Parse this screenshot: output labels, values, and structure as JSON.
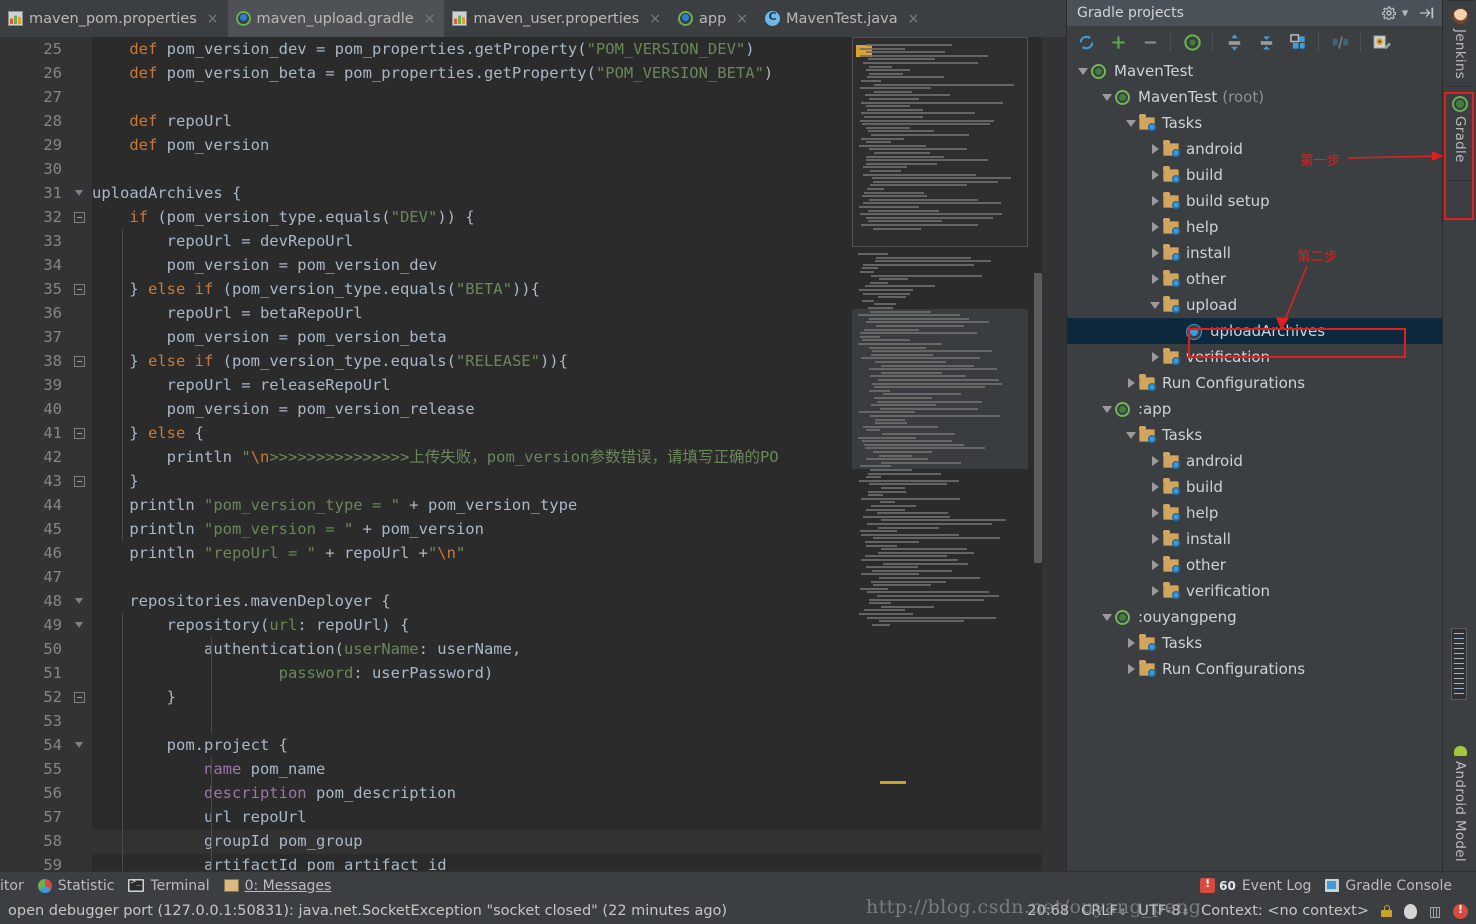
{
  "tabs": [
    {
      "label": "maven_pom.properties",
      "icon": "properties-file-icon",
      "active": false
    },
    {
      "label": "maven_upload.gradle",
      "icon": "gradle-file-icon",
      "active": true
    },
    {
      "label": "maven_user.properties",
      "icon": "properties-file-icon",
      "active": false
    },
    {
      "label": "app",
      "icon": "gradle-file-icon",
      "active": false
    },
    {
      "label": "MavenTest.java",
      "icon": "java-class-icon",
      "active": false
    }
  ],
  "editor": {
    "first_line": 25,
    "lines": [
      {
        "n": 25,
        "html": "    <span class=\"kw\">def</span> pom_version_dev = pom_properties.getProperty(<span class=\"str\">\"POM_VERSION_DEV\"</span>)"
      },
      {
        "n": 26,
        "html": "    <span class=\"kw\">def</span> pom_version_beta = pom_properties.getProperty(<span class=\"str\">\"POM_VERSION_BETA\"</span>)"
      },
      {
        "n": 27,
        "html": ""
      },
      {
        "n": 28,
        "html": "    <span class=\"kw\">def</span> repoUrl"
      },
      {
        "n": 29,
        "html": "    <span class=\"kw\">def</span> pom_version"
      },
      {
        "n": 30,
        "html": ""
      },
      {
        "n": 31,
        "html": "uploadArchives {"
      },
      {
        "n": 32,
        "html": "    <span class=\"kw\">if</span> (pom_version_type.equals(<span class=\"str\">\"DEV\"</span>)) {"
      },
      {
        "n": 33,
        "html": "        repoUrl = devRepoUrl"
      },
      {
        "n": 34,
        "html": "        pom_version = pom_version_dev"
      },
      {
        "n": 35,
        "html": "    } <span class=\"kw\">else if</span> (pom_version_type.equals(<span class=\"str\">\"BETA\"</span>)){"
      },
      {
        "n": 36,
        "html": "        repoUrl = betaRepoUrl"
      },
      {
        "n": 37,
        "html": "        pom_version = pom_version_beta"
      },
      {
        "n": 38,
        "html": "    } <span class=\"kw\">else if</span> (pom_version_type.equals(<span class=\"str\">\"RELEASE\"</span>)){"
      },
      {
        "n": 39,
        "html": "        repoUrl = releaseRepoUrl"
      },
      {
        "n": 40,
        "html": "        pom_version = pom_version_release"
      },
      {
        "n": 41,
        "html": "    } <span class=\"kw\">else</span> {"
      },
      {
        "n": 42,
        "html": "        println <span class=\"str\">\"<span class=\"esc\">\\n</span>&gt;&gt;&gt;&gt;&gt;&gt;&gt;&gt;&gt;&gt;&gt;&gt;&gt;&gt;&gt;上传失败，pom_version参数错误，请填写正确的PO</span>"
      },
      {
        "n": 43,
        "html": "    }"
      },
      {
        "n": 44,
        "html": "    println <span class=\"str\">\"pom_version_type = \"</span> + pom_version_type"
      },
      {
        "n": 45,
        "html": "    println <span class=\"str\">\"pom_version = \"</span> + pom_version"
      },
      {
        "n": 46,
        "html": "    println <span class=\"str\">\"repoUrl = \"</span> + repoUrl +<span class=\"str\">\"<span class=\"esc\">\\n</span>\"</span>"
      },
      {
        "n": 47,
        "html": ""
      },
      {
        "n": 48,
        "html": "    repositories.mavenDeployer {"
      },
      {
        "n": 49,
        "html": "        repository(<span class=\"lbl\">url</span>: repoUrl) {"
      },
      {
        "n": 50,
        "html": "            authentication(<span class=\"lbl\">userName</span>: userName,"
      },
      {
        "n": 51,
        "html": "                    <span class=\"lbl\">password</span>: userPassword)"
      },
      {
        "n": 52,
        "html": "        }"
      },
      {
        "n": 53,
        "html": ""
      },
      {
        "n": 54,
        "html": "        pom.project {"
      },
      {
        "n": 55,
        "html": "            <span class=\"attr\">name</span> pom_name"
      },
      {
        "n": 56,
        "html": "            <span class=\"attr\">description</span> pom_description"
      },
      {
        "n": 57,
        "html": "            url repoUrl"
      },
      {
        "n": 58,
        "html": "            groupId pom_group"
      },
      {
        "n": 59,
        "html": "            artifactId pom_artifact_id"
      }
    ]
  },
  "gradle_panel": {
    "title": "Gradle projects",
    "toolbar": [
      {
        "name": "refresh-all-gradle-projects-icon",
        "glyph": "refresh"
      },
      {
        "name": "attach-gradle-project-icon",
        "glyph": "plus"
      },
      {
        "name": "detach-external-project-icon",
        "glyph": "minus"
      },
      {
        "name": "execute-gradle-task-icon",
        "glyph": "gradle"
      },
      {
        "name": "expand-all-icon",
        "glyph": "expand"
      },
      {
        "name": "collapse-all-icon",
        "glyph": "collapse"
      },
      {
        "name": "show-modules-icon",
        "glyph": "modules"
      },
      {
        "name": "toggle-offline-mode-icon",
        "glyph": "offline"
      },
      {
        "name": "gradle-settings-icon",
        "glyph": "settings"
      }
    ],
    "tree": [
      {
        "label": "MavenTest",
        "suffix": "",
        "indent": 0,
        "twisty": "down",
        "icon": "gradle-project-icon",
        "selected": false
      },
      {
        "label": "MavenTest",
        "suffix": "(root)",
        "indent": 1,
        "twisty": "down",
        "icon": "gradle-project-icon",
        "selected": false
      },
      {
        "label": "Tasks",
        "suffix": "",
        "indent": 2,
        "twisty": "down",
        "icon": "task-folder-icon",
        "selected": false
      },
      {
        "label": "android",
        "suffix": "",
        "indent": 3,
        "twisty": "right",
        "icon": "task-folder-icon",
        "selected": false
      },
      {
        "label": "build",
        "suffix": "",
        "indent": 3,
        "twisty": "right",
        "icon": "task-folder-icon",
        "selected": false
      },
      {
        "label": "build setup",
        "suffix": "",
        "indent": 3,
        "twisty": "right",
        "icon": "task-folder-icon",
        "selected": false
      },
      {
        "label": "help",
        "suffix": "",
        "indent": 3,
        "twisty": "right",
        "icon": "task-folder-icon",
        "selected": false
      },
      {
        "label": "install",
        "suffix": "",
        "indent": 3,
        "twisty": "right",
        "icon": "task-folder-icon",
        "selected": false
      },
      {
        "label": "other",
        "suffix": "",
        "indent": 3,
        "twisty": "right",
        "icon": "task-folder-icon",
        "selected": false
      },
      {
        "label": "upload",
        "suffix": "",
        "indent": 3,
        "twisty": "down",
        "icon": "task-folder-icon",
        "selected": false
      },
      {
        "label": "uploadArchives",
        "suffix": "",
        "indent": 4,
        "twisty": "none",
        "icon": "gradle-task-icon",
        "selected": true
      },
      {
        "label": "verification",
        "suffix": "",
        "indent": 3,
        "twisty": "right",
        "icon": "task-folder-icon",
        "selected": false
      },
      {
        "label": "Run Configurations",
        "suffix": "",
        "indent": 2,
        "twisty": "right",
        "icon": "task-folder-icon",
        "selected": false
      },
      {
        "label": ":app",
        "suffix": "",
        "indent": 1,
        "twisty": "down",
        "icon": "gradle-project-icon",
        "selected": false
      },
      {
        "label": "Tasks",
        "suffix": "",
        "indent": 2,
        "twisty": "down",
        "icon": "task-folder-icon",
        "selected": false
      },
      {
        "label": "android",
        "suffix": "",
        "indent": 3,
        "twisty": "right",
        "icon": "task-folder-icon",
        "selected": false
      },
      {
        "label": "build",
        "suffix": "",
        "indent": 3,
        "twisty": "right",
        "icon": "task-folder-icon",
        "selected": false
      },
      {
        "label": "help",
        "suffix": "",
        "indent": 3,
        "twisty": "right",
        "icon": "task-folder-icon",
        "selected": false
      },
      {
        "label": "install",
        "suffix": "",
        "indent": 3,
        "twisty": "right",
        "icon": "task-folder-icon",
        "selected": false
      },
      {
        "label": "other",
        "suffix": "",
        "indent": 3,
        "twisty": "right",
        "icon": "task-folder-icon",
        "selected": false
      },
      {
        "label": "verification",
        "suffix": "",
        "indent": 3,
        "twisty": "right",
        "icon": "task-folder-icon",
        "selected": false
      },
      {
        "label": ":ouyangpeng",
        "suffix": "",
        "indent": 1,
        "twisty": "down",
        "icon": "gradle-project-icon",
        "selected": false
      },
      {
        "label": "Tasks",
        "suffix": "",
        "indent": 2,
        "twisty": "right",
        "icon": "task-folder-icon",
        "selected": false
      },
      {
        "label": "Run Configurations",
        "suffix": "",
        "indent": 2,
        "twisty": "right",
        "icon": "task-folder-icon",
        "selected": false
      }
    ]
  },
  "annotations": {
    "step1": "第一步",
    "step2": "第二步",
    "accent_color": "#e02020"
  },
  "right_toolbar": [
    {
      "label": "Jenkins",
      "icon": "jenkins-avatar-icon"
    },
    {
      "label": "Gradle",
      "icon": "gradle-icon"
    },
    {
      "label": "Android Model",
      "icon": "android-icon"
    }
  ],
  "bottom_toolwindows": {
    "left_partial": "itor",
    "items": [
      {
        "label": "Statistic",
        "icon": "statistic-icon"
      },
      {
        "label": "Terminal",
        "icon": "terminal-icon"
      },
      {
        "label": "0: Messages",
        "icon": "messages-icon",
        "mnemonic": "0"
      }
    ],
    "right_items": [
      {
        "label": "Event Log",
        "icon": "event-log-icon",
        "badge": "60"
      },
      {
        "label": "Gradle Console",
        "icon": "gradle-console-icon"
      }
    ]
  },
  "statusbar": {
    "message": "open debugger port (127.0.0.1:50831): java.net.SocketException \"socket closed\" (22 minutes ago)",
    "caret": "20:68",
    "line_separator": "CRLF",
    "encoding": "UTF-8",
    "context": "Context: <no context>"
  },
  "watermark": "http://blog.csdn.net/ouyang_peng"
}
